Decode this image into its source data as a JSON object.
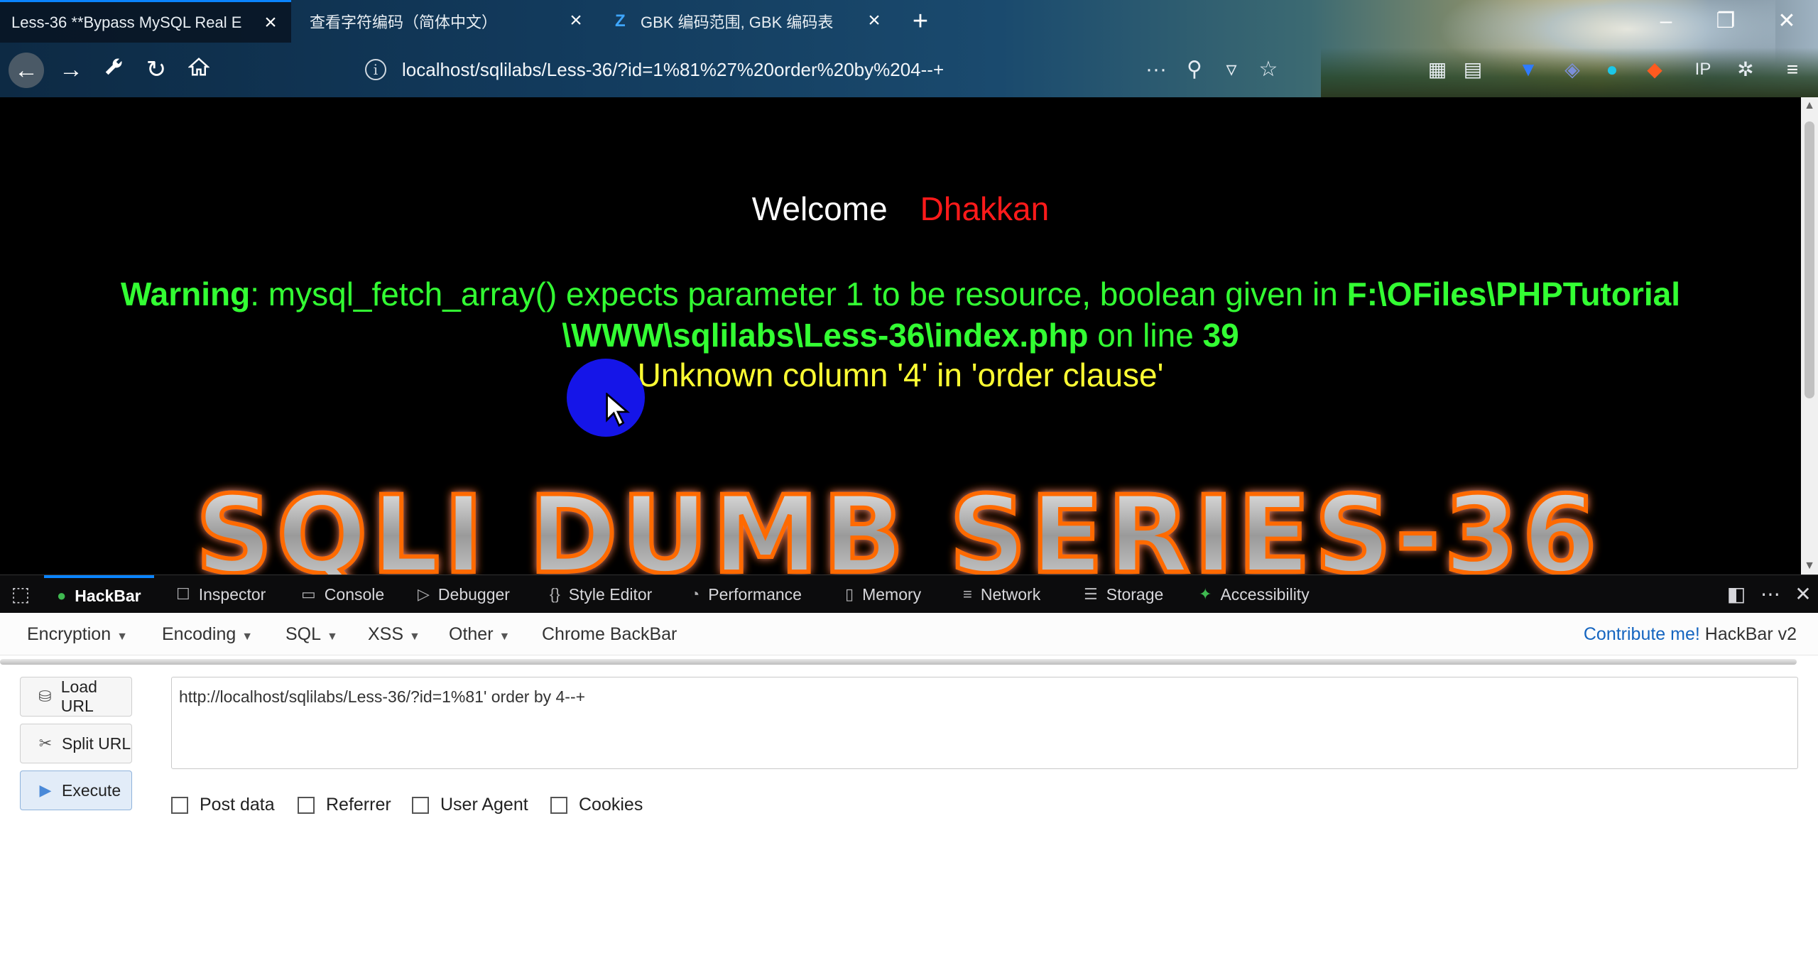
{
  "browser": {
    "tabs": [
      {
        "title": "Less-36 **Bypass MySQL Real E",
        "active": true
      },
      {
        "title": "查看字符编码（简体中文）",
        "active": false
      },
      {
        "title": "GBK 编码范围, GBK 编码表",
        "favicon": "Z",
        "active": false
      }
    ],
    "url": "localhost/sqlilabs/Less-36/?id=1%81%27%20order%20by%204--+"
  },
  "page": {
    "welcome": "Welcome",
    "name": "Dhakkan",
    "warning_label": "Warning",
    "warning_text": ": mysql_fetch_array() expects parameter 1 to be resource, boolean given in ",
    "warning_path": "F:\\OFiles\\PHPTutorial \\WWW\\sqlilabs\\Less-36\\index.php",
    "warning_online": " on line ",
    "warning_line": "39",
    "sql_error": "Unknown column '4' in 'order clause'",
    "banner": "SQLI DUMB SERIES-36"
  },
  "devtools": {
    "tabs": [
      "HackBar",
      "Inspector",
      "Console",
      "Debugger",
      "Style Editor",
      "Performance",
      "Memory",
      "Network",
      "Storage",
      "Accessibility"
    ],
    "active_tab": "HackBar"
  },
  "hackbar": {
    "menus": [
      "Encryption",
      "Encoding",
      "SQL",
      "XSS",
      "Other"
    ],
    "chrome_backbar": "Chrome BackBar",
    "contribute": "Contribute me!",
    "version": "HackBar v2",
    "load_url": "Load URL",
    "split_url": "Split URL",
    "execute": "Execute",
    "url_value": "http://localhost/sqlilabs/Less-36/?id=1%81' order by 4--+",
    "checkboxes": [
      "Post data",
      "Referrer",
      "User Agent",
      "Cookies"
    ]
  },
  "colors": {
    "accent": "#0a84ff",
    "welcome_name": "#ff1a1a",
    "warning": "#33ff33",
    "sql_error": "#ffff33",
    "banner_glow": "#ff6a00"
  }
}
